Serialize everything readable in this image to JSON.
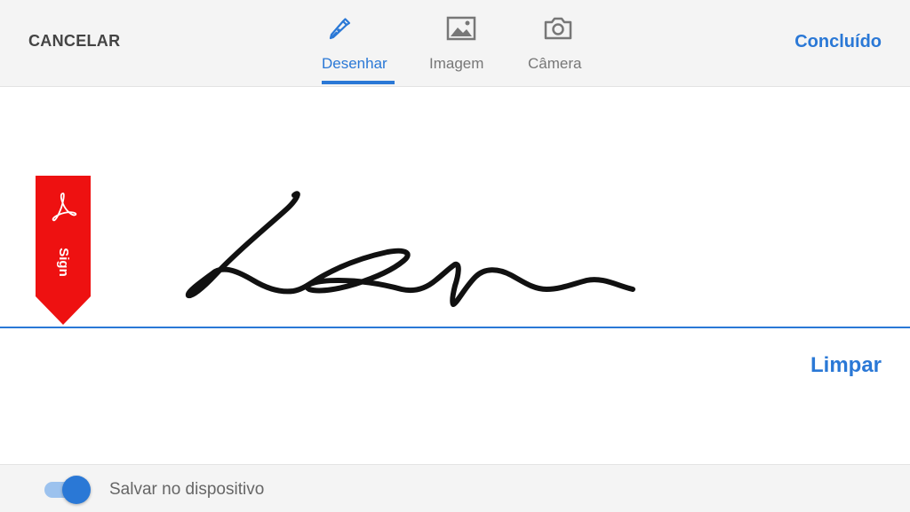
{
  "header": {
    "cancel_label": "CANCELAR",
    "done_label": "Concluído",
    "tabs": [
      {
        "label": "Desenhar",
        "icon": "pen-icon",
        "active": true
      },
      {
        "label": "Imagem",
        "icon": "image-icon",
        "active": false
      },
      {
        "label": "Câmera",
        "icon": "camera-icon",
        "active": false
      }
    ]
  },
  "canvas": {
    "badge_text": "Sign",
    "badge_logo": "acrobat-logo-icon",
    "clear_label": "Limpar"
  },
  "footer": {
    "save_toggle_on": true,
    "save_label": "Salvar no dispositivo"
  },
  "colors": {
    "accent": "#2a78d6",
    "badge": "#ee1111",
    "bar_background": "#f4f4f4"
  }
}
